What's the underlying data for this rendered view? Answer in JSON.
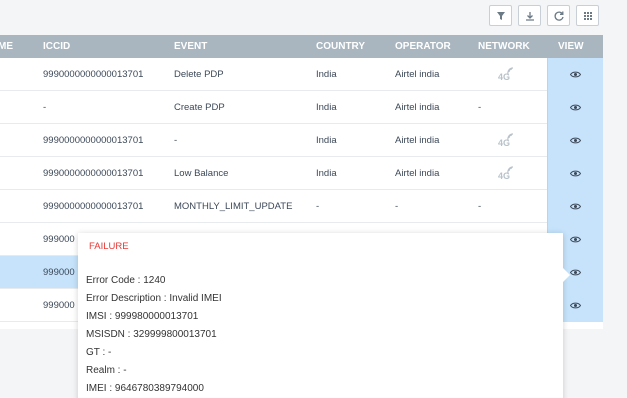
{
  "toolbar": {
    "buttons": [
      {
        "name": "filter-icon"
      },
      {
        "name": "download-icon"
      },
      {
        "name": "refresh-icon"
      },
      {
        "name": "grid-icon"
      }
    ]
  },
  "table": {
    "columns": {
      "me": "ME",
      "iccid": "ICCID",
      "event": "EVENT",
      "country": "COUNTRY",
      "operator": "OPERATOR",
      "network": "NETWORK",
      "view": "VIEW"
    },
    "rows": [
      {
        "iccid": "9990000000000013701",
        "event": "Delete PDP",
        "country": "India",
        "operator": "Airtel india",
        "network": "4G",
        "highlight": false
      },
      {
        "iccid": "-",
        "event": "Create PDP",
        "country": "India",
        "operator": "Airtel india",
        "network": "-",
        "highlight": false
      },
      {
        "iccid": "9990000000000013701",
        "event": "-",
        "country": "India",
        "operator": "Airtel india",
        "network": "4G",
        "highlight": false
      },
      {
        "iccid": "9990000000000013701",
        "event": "Low Balance",
        "country": "India",
        "operator": "Airtel india",
        "network": "4G",
        "highlight": false
      },
      {
        "iccid": "9990000000000013701",
        "event": "MONTHLY_LIMIT_UPDATE",
        "country": "-",
        "operator": "-",
        "network": "-",
        "highlight": false
      },
      {
        "iccid": "999000",
        "event": "",
        "country": "",
        "operator": "",
        "network": "",
        "highlight": false
      },
      {
        "iccid": "999000",
        "event": "",
        "country": "",
        "operator": "",
        "network": "",
        "highlight": true
      },
      {
        "iccid": "999000",
        "event": "",
        "country": "",
        "operator": "",
        "network": "",
        "highlight": false
      }
    ]
  },
  "popover": {
    "title": "FAILURE",
    "lines": [
      "Error Code : 1240",
      "Error Description : Invalid IMEI",
      "IMSI : 999980000013701",
      "MSISDN : 329999800013701",
      "GT : -",
      "Realm : -",
      "IMEI : 9646780389794000"
    ]
  },
  "colors": {
    "header_bg": "#a9b6c0",
    "view_col_bg": "#c6e3fb",
    "failure_red": "#e53935",
    "network_icon": "#b8c2ca"
  }
}
